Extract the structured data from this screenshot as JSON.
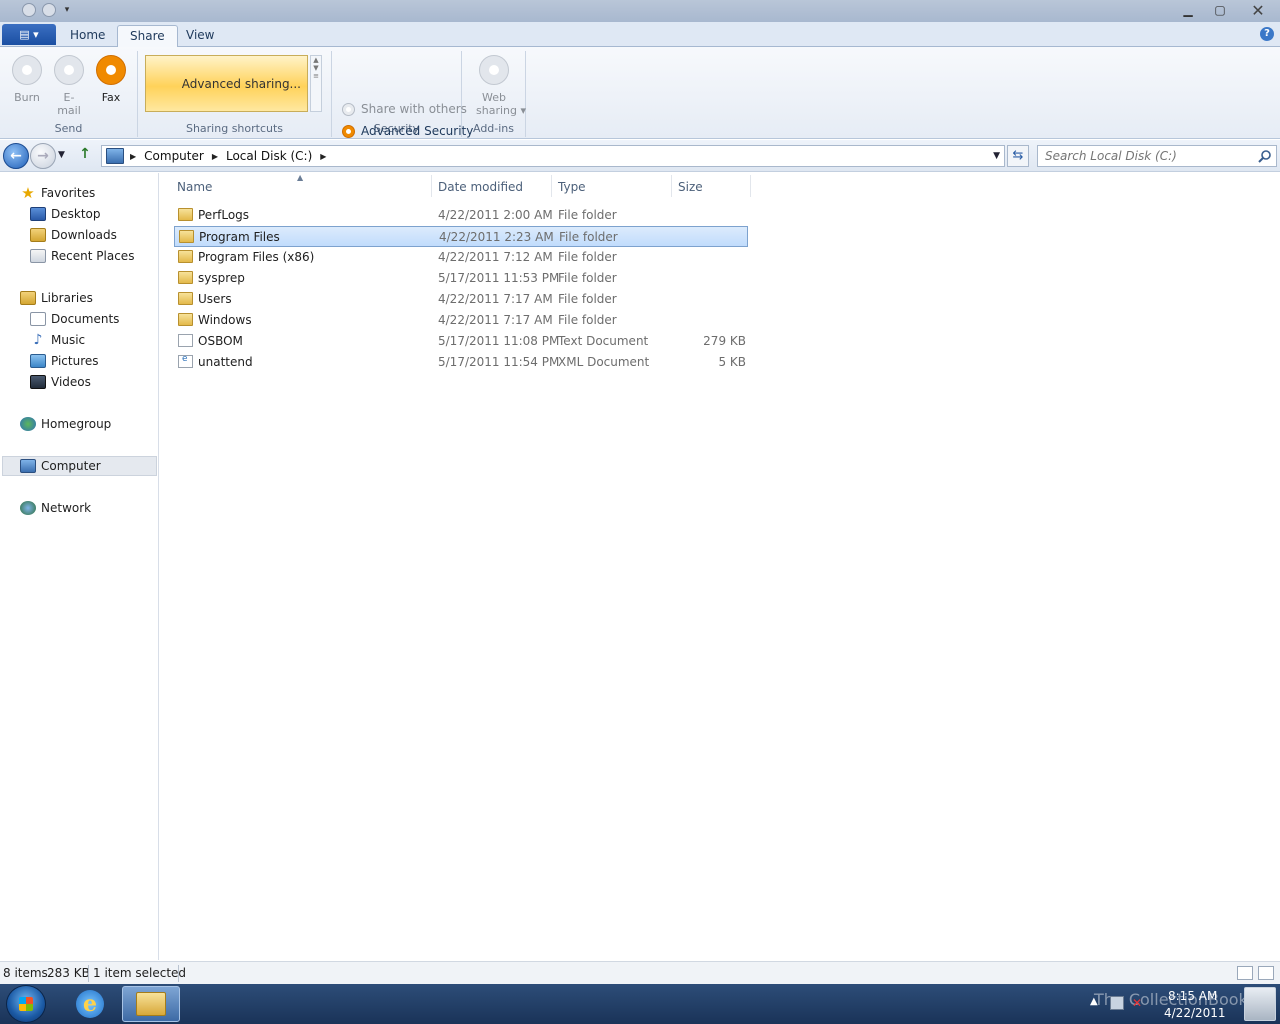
{
  "titlebar": {
    "minimize": "▁",
    "maximize": "▢",
    "close": "✕",
    "qat_dropdown": "▾"
  },
  "ribbon_tabs": {
    "app_menu": "▤ ▾",
    "tabs": [
      "Home",
      "Share",
      "View"
    ],
    "active": "Share",
    "help": "?"
  },
  "ribbon": {
    "send": {
      "label": "Send",
      "burn": "Burn",
      "email_line1": "E-",
      "email_line2": "mail",
      "fax": "Fax"
    },
    "sharing_shortcuts": {
      "label": "Sharing shortcuts",
      "item": "Advanced sharing..."
    },
    "security": {
      "label": "Security",
      "share_with_others": "Share with others",
      "advanced_security": "Advanced Security"
    },
    "addins": {
      "label": "Add-ins",
      "web_sharing_line1": "Web",
      "web_sharing_line2": "sharing ▾"
    }
  },
  "address": {
    "crumbs": [
      "Computer",
      "Local Disk (C:)"
    ],
    "search_placeholder": "Search Local Disk (C:)",
    "refresh": "⇆",
    "back": "←",
    "forward": "→",
    "dropdown": "▼",
    "up": "↑"
  },
  "navpane": {
    "favorites": "Favorites",
    "desktop": "Desktop",
    "downloads": "Downloads",
    "recent_places": "Recent Places",
    "libraries": "Libraries",
    "documents": "Documents",
    "music": "Music",
    "pictures": "Pictures",
    "videos": "Videos",
    "homegroup": "Homegroup",
    "computer": "Computer",
    "network": "Network",
    "star": "★",
    "note": "♪"
  },
  "filelist": {
    "columns": [
      "Name",
      "Date modified",
      "Type",
      "Size"
    ],
    "sort_indicator": "▲",
    "rows": [
      {
        "name": "PerfLogs",
        "date": "4/22/2011 2:00 AM",
        "type": "File folder",
        "size": "",
        "icon": "folder"
      },
      {
        "name": "Program Files",
        "date": "4/22/2011 2:23 AM",
        "type": "File folder",
        "size": "",
        "icon": "folder",
        "selected": true
      },
      {
        "name": "Program Files (x86)",
        "date": "4/22/2011 7:12 AM",
        "type": "File folder",
        "size": "",
        "icon": "folder"
      },
      {
        "name": "sysprep",
        "date": "5/17/2011 11:53 PM",
        "type": "File folder",
        "size": "",
        "icon": "folder"
      },
      {
        "name": "Users",
        "date": "4/22/2011 7:17 AM",
        "type": "File folder",
        "size": "",
        "icon": "folder"
      },
      {
        "name": "Windows",
        "date": "4/22/2011 7:17 AM",
        "type": "File folder",
        "size": "",
        "icon": "folder"
      },
      {
        "name": "OSBOM",
        "date": "5/17/2011 11:08 PM",
        "type": "Text Document",
        "size": "279 KB",
        "icon": "text"
      },
      {
        "name": "unattend",
        "date": "5/17/2011 11:54 PM",
        "type": "XML Document",
        "size": "5 KB",
        "icon": "xml"
      }
    ]
  },
  "statusbar": {
    "items": "8 items",
    "size": "283 KB",
    "selected": "1 item selected"
  },
  "taskbar": {
    "watermark": "The CollectionBook",
    "time": "8:15 AM",
    "date": "4/22/2011",
    "ie_glyph": "e"
  }
}
